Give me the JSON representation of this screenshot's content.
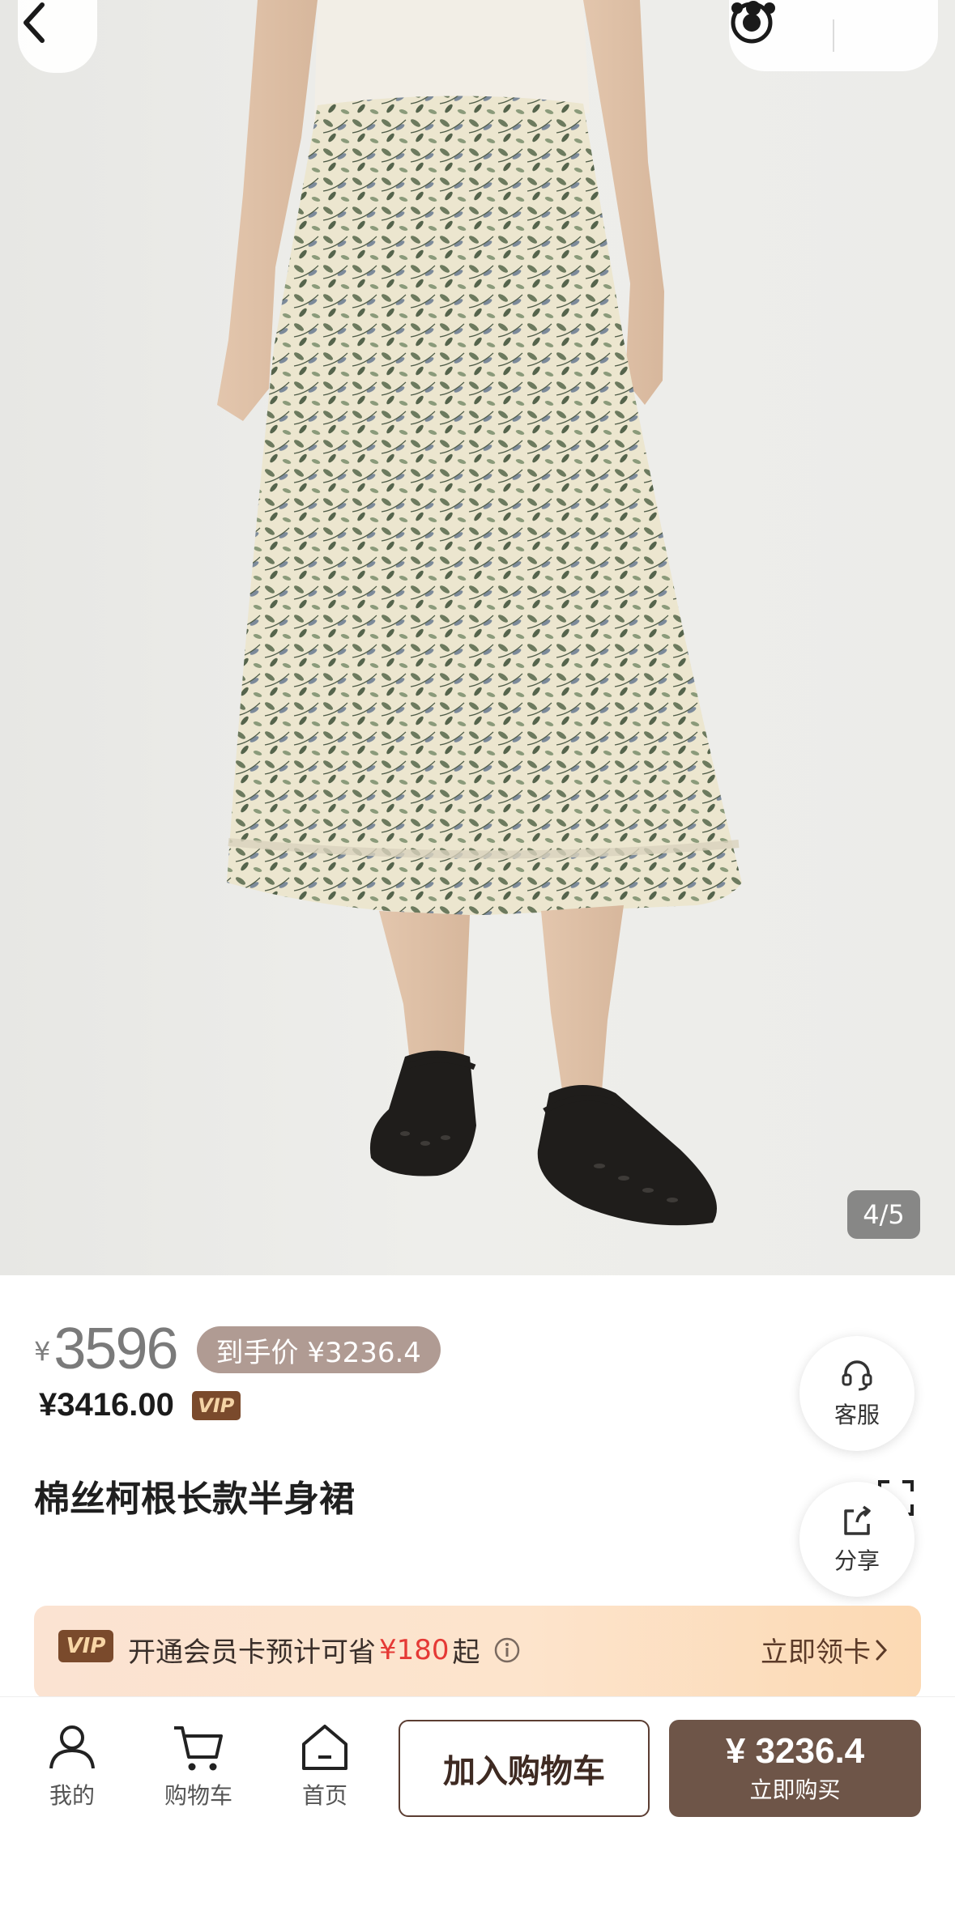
{
  "gallery": {
    "counter": "4/5"
  },
  "price": {
    "currency": "¥",
    "main": "3596",
    "hand_price": "到手价 ¥3236.4",
    "vip_price": "¥3416.00",
    "vip_badge": "VIP"
  },
  "product": {
    "title": "棉丝柯根长款半身裙"
  },
  "floating": {
    "service_label": "客服",
    "share_label": "分享"
  },
  "membership": {
    "badge": "VIP",
    "text_before": "开通会员卡预计可省",
    "save_amount": "¥180",
    "text_after": "起",
    "cta": "立即领卡"
  },
  "bottom_bar": {
    "tabs": [
      {
        "label": "我的",
        "icon": "user-icon"
      },
      {
        "label": "购物车",
        "icon": "cart-icon"
      },
      {
        "label": "首页",
        "icon": "home-icon"
      }
    ],
    "add_to_cart": "加入购物车",
    "buy_price": "¥ 3236.4",
    "buy_label": "立即购买"
  },
  "colors": {
    "brand_brown": "#6e5548",
    "vip_brown": "#7a4a2c",
    "save_red": "#e53935",
    "hand_price_bg": "#b09b93"
  }
}
